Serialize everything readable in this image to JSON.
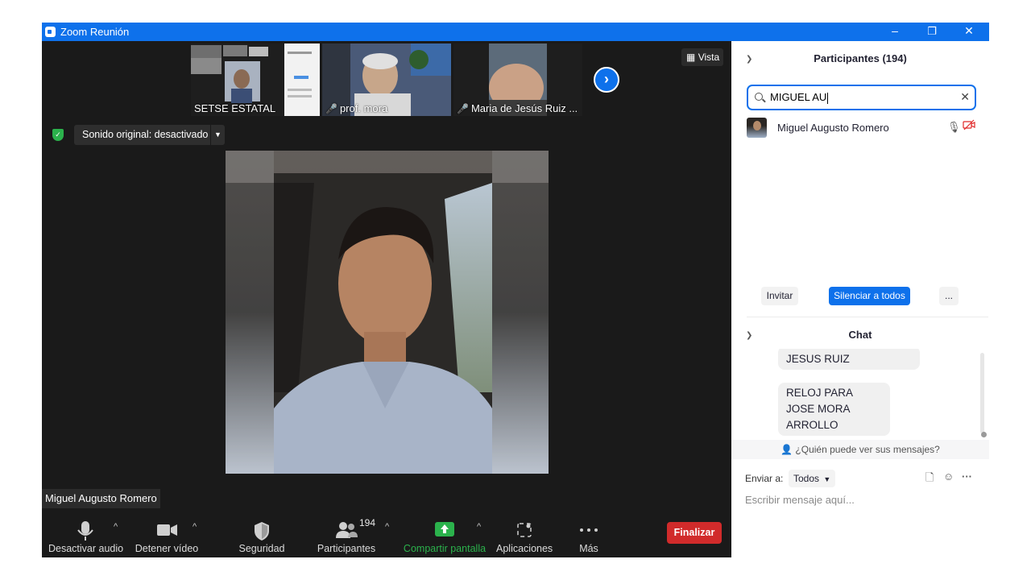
{
  "window": {
    "title": "Zoom Reunión",
    "minimize": "–",
    "restore": "❐",
    "close": "✕"
  },
  "thumbnails": [
    {
      "name": "SETSE ESTATAL",
      "muted": false
    },
    {
      "name": "prof. mora",
      "muted": true
    },
    {
      "name": "Maria de Jesús Ruiz ...",
      "muted": true
    }
  ],
  "vista": {
    "label": "Vista"
  },
  "sound": {
    "label": "Sonido original: desactivado"
  },
  "speaker": {
    "name": "Miguel Augusto Romero"
  },
  "toolbar": {
    "mute_label": "Desactivar audio",
    "video_label": "Detener vídeo",
    "security_label": "Seguridad",
    "participants_label": "Participantes",
    "participants_count": "194",
    "share_label": "Compartir pantalla",
    "apps_label": "Aplicaciones",
    "more_label": "Más",
    "end_label": "Finalizar"
  },
  "participants_panel": {
    "title": "Participantes (194)",
    "search_value": "MIGUEL AU",
    "results": [
      {
        "name": "Miguel Augusto Romero",
        "audio": "unmuted",
        "video": "off"
      }
    ],
    "invite_label": "Invitar",
    "mute_all_label": "Silenciar a todos",
    "more_label": "..."
  },
  "chat": {
    "title": "Chat",
    "messages": [
      {
        "text": "JESUS RUIZ"
      },
      {
        "text": "RELOJ PARA JOSE MORA ARROLLO"
      }
    ],
    "visibility_link": "¿Quién puede ver sus mensajes?",
    "send_to_label": "Enviar a:",
    "recipient": "Todos",
    "input_placeholder": "Escribir mensaje aquí..."
  },
  "colors": {
    "accent": "#0e71eb",
    "end": "#d12b2b",
    "share": "#2bb24c",
    "muted": "#e02828"
  }
}
